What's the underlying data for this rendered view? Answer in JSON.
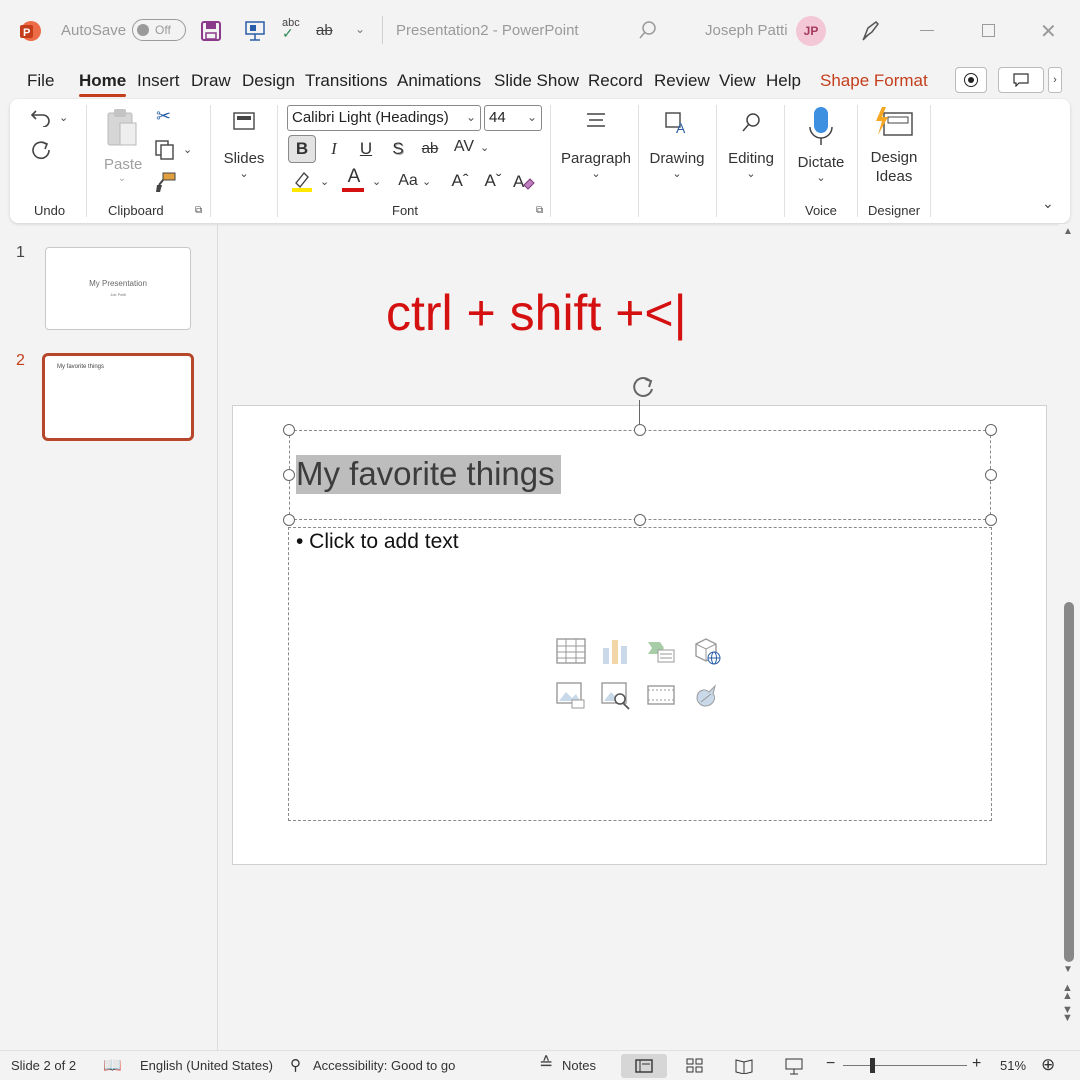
{
  "window": {
    "autosave_label": "AutoSave",
    "autosave_state": "Off",
    "title": "Presentation2  -  PowerPoint",
    "user_name": "Joseph Patti",
    "user_initials": "JP"
  },
  "tabs": [
    {
      "label": "File"
    },
    {
      "label": "Home"
    },
    {
      "label": "Insert"
    },
    {
      "label": "Draw"
    },
    {
      "label": "Design"
    },
    {
      "label": "Transitions"
    },
    {
      "label": "Animations"
    },
    {
      "label": "Slide Show"
    },
    {
      "label": "Record"
    },
    {
      "label": "Review"
    },
    {
      "label": "View"
    },
    {
      "label": "Help"
    },
    {
      "label": "Shape Format"
    }
  ],
  "active_tab": "Home",
  "ribbon": {
    "undo_group": "Undo",
    "clipboard_group": "Clipboard",
    "paste_label": "Paste",
    "slides_label": "Slides",
    "font_name": "Calibri Light (Headings)",
    "font_size": "44",
    "font_group": "Font",
    "bold": "B",
    "italic": "I",
    "underline": "U",
    "shadow": "S",
    "strike": "ab",
    "spacing": "AV",
    "change_case": "Aa",
    "grow": "Aˆ",
    "shrink": "Aˇ",
    "paragraph_label": "Paragraph",
    "drawing_label": "Drawing",
    "editing_label": "Editing",
    "dictate_label": "Dictate",
    "voice_group": "Voice",
    "design_ideas_l1": "Design",
    "design_ideas_l2": "Ideas",
    "designer_group": "Designer"
  },
  "thumbnails": [
    {
      "num": "1",
      "title": "My Presentation",
      "subtitle": "Joe Patti"
    },
    {
      "num": "2",
      "title": "My favorite things"
    }
  ],
  "overlay": "ctrl + shift +<|",
  "slide": {
    "title": "My favorite things",
    "body": "• Click to add text"
  },
  "status": {
    "slide_counter": "Slide 2 of 2",
    "language": "English (United States)",
    "accessibility": "Accessibility: Good to go",
    "notes": "Notes",
    "zoom": "51%"
  },
  "colors": {
    "accent": "#c43e1c",
    "overlay": "#d41010",
    "selection": "#bdbdbd"
  }
}
